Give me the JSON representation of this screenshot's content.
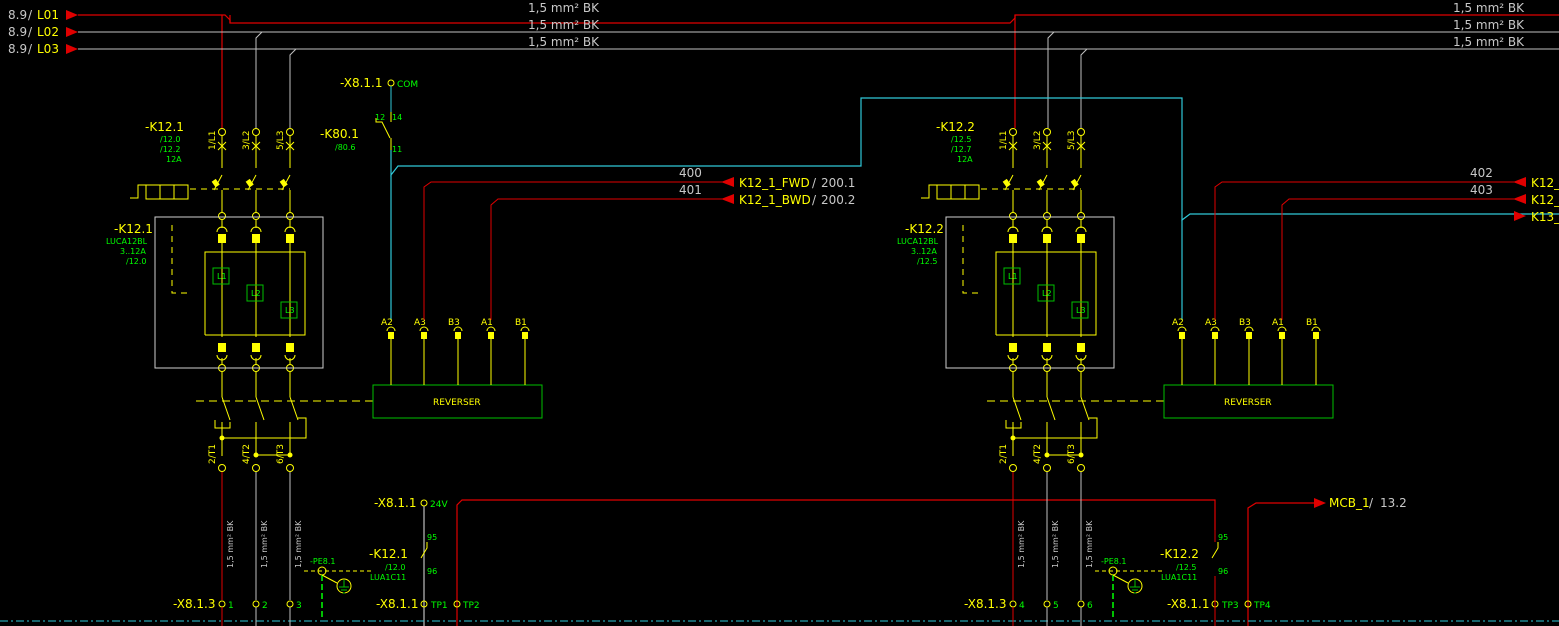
{
  "colors": {
    "background": "#000000",
    "phase_l1": "#e00000",
    "phase_l2_l3": "#bfbfbf",
    "control": "#e00000",
    "com_link": "#30c8d8",
    "device": "#ffff00",
    "terminal": "#ffff00",
    "label_green": "#00ff00",
    "box_white": "#d0d0d0",
    "reverser_box": "#00c000",
    "pe": "#00c000",
    "bottom_rail": "#30c8d8"
  },
  "sources": [
    {
      "ref": "8.9",
      "name": "L01"
    },
    {
      "ref": "8.9",
      "name": "L02"
    },
    {
      "ref": "8.9",
      "name": "L03"
    }
  ],
  "wire_spec": "1,5 mm² BK",
  "com_terminal": {
    "tag": "-X8.1.1",
    "pin": "COM"
  },
  "relay_k80": {
    "tag": "-K80.1",
    "ref": "/80.6",
    "pins": [
      "12",
      "14",
      "11"
    ]
  },
  "supply_terminal": {
    "tag": "-X8.1.1",
    "pin": "24V"
  },
  "mcb": {
    "name": "MCB_1",
    "ref": "13.2"
  },
  "starters": [
    {
      "tag": "-K12.1",
      "refs": [
        "/12.0",
        "/12.2",
        "12A"
      ],
      "breaker_tag": "-K12.1",
      "breaker_info": [
        "LUCA12BL",
        "3..12A",
        "/12.0"
      ],
      "pin_top": [
        "1/L1",
        "3/L2",
        "5/L3"
      ],
      "pin_bottom": [
        "2/T1",
        "4/T2",
        "6/T3"
      ],
      "trip_labels": [
        "L1",
        "L2",
        "L3"
      ],
      "reverser": "REVERSER",
      "rev_pins": [
        "A2",
        "A3",
        "B3",
        "A1",
        "B1"
      ],
      "signals": [
        {
          "num": "400",
          "name": "K12_1_FWD",
          "ref": "200.1"
        },
        {
          "num": "401",
          "name": "K12_1_BWD",
          "ref": "200.2"
        }
      ],
      "aux_tag": "-K12.1",
      "aux_info": [
        "/12.0",
        "LUA1C11"
      ],
      "aux_pins": [
        "95",
        "96"
      ],
      "pe": "-PE8.1",
      "motor_terminal": "-X8.1.3",
      "motor_pins": [
        "1",
        "2",
        "3"
      ],
      "tp_terminal": "-X8.1.1",
      "tp_pins": [
        "TP1",
        "TP2"
      ]
    },
    {
      "tag": "-K12.2",
      "refs": [
        "/12.5",
        "/12.7",
        "12A"
      ],
      "breaker_tag": "-K12.2",
      "breaker_info": [
        "LUCA12BL",
        "3..12A",
        "/12.5"
      ],
      "pin_top": [
        "1/L1",
        "3/L2",
        "5/L3"
      ],
      "pin_bottom": [
        "2/T1",
        "4/T2",
        "6/T3"
      ],
      "trip_labels": [
        "L1",
        "L2",
        "L3"
      ],
      "reverser": "REVERSER",
      "rev_pins": [
        "A2",
        "A3",
        "B3",
        "A1",
        "B1"
      ],
      "signals": [
        {
          "num": "402",
          "name": "K12_",
          "ref": ""
        },
        {
          "num": "403",
          "name": "K12_",
          "ref": ""
        },
        {
          "num": "",
          "name": "K13_",
          "ref": ""
        }
      ],
      "aux_tag": "-K12.2",
      "aux_info": [
        "/12.5",
        "LUA1C11"
      ],
      "aux_pins": [
        "95",
        "96"
      ],
      "pe": "-PE8.1",
      "motor_terminal": "-X8.1.3",
      "motor_pins": [
        "4",
        "5",
        "6"
      ],
      "tp_terminal": "-X8.1.1",
      "tp_pins": [
        "TP3",
        "TP4"
      ]
    }
  ]
}
